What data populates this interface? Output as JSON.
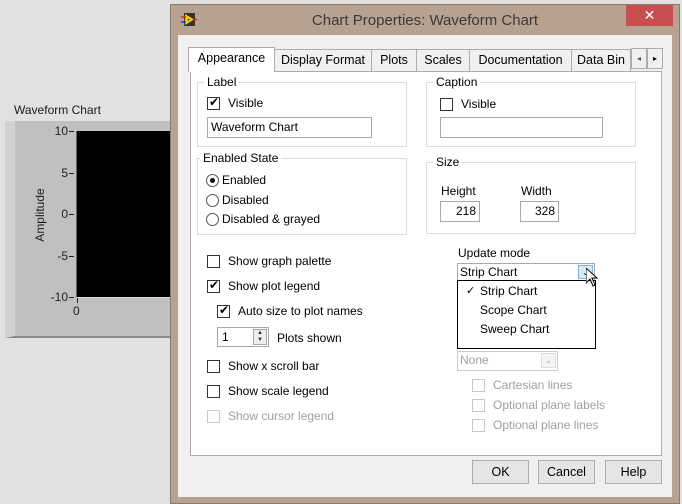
{
  "front_panel": {
    "chart_label": "Waveform Chart",
    "y_axis_label": "Amplitude",
    "y_ticks": [
      "10",
      "5",
      "0",
      "-5",
      "-10"
    ],
    "x_ticks": [
      "0"
    ]
  },
  "dialog": {
    "title": "Chart Properties: Waveform Chart",
    "close_glyph": "✕",
    "tabs": [
      {
        "label": "Appearance",
        "active": true
      },
      {
        "label": "Display Format"
      },
      {
        "label": "Plots"
      },
      {
        "label": "Scales"
      },
      {
        "label": "Documentation"
      },
      {
        "label": "Data Bin"
      }
    ],
    "tab_scroll_left": "◂",
    "tab_scroll_right": "▸",
    "label_group": {
      "title": "Label",
      "visible_label": "Visible",
      "visible_checked": true,
      "text_value": "Waveform Chart"
    },
    "caption_group": {
      "title": "Caption",
      "visible_label": "Visible",
      "visible_checked": false,
      "text_value": ""
    },
    "enabled_state": {
      "title": "Enabled State",
      "options": [
        "Enabled",
        "Disabled",
        "Disabled & grayed"
      ],
      "selected": "Enabled"
    },
    "size_group": {
      "title": "Size",
      "height_label": "Height",
      "height_value": "218",
      "width_label": "Width",
      "width_value": "328"
    },
    "options": {
      "show_graph_palette": "Show graph palette",
      "show_plot_legend": "Show plot legend",
      "auto_size": "Auto size to plot names",
      "plots_shown_value": "1",
      "plots_shown_label": "Plots shown",
      "show_x_scroll": "Show x scroll bar",
      "show_scale_legend": "Show scale legend",
      "show_cursor_legend": "Show cursor legend"
    },
    "update_mode": {
      "label": "Update mode",
      "value": "Strip Chart",
      "menu_items": [
        "Strip Chart",
        "Scope Chart",
        "Sweep Chart"
      ],
      "checked_item": "Strip Chart",
      "check_glyph": "✓",
      "arrow_glyph": "⌄"
    },
    "special_plane": {
      "value": "None",
      "arrow_glyph": "⌄"
    },
    "plane_options": [
      "Cartesian lines",
      "Optional plane labels",
      "Optional plane lines"
    ],
    "buttons": {
      "ok": "OK",
      "cancel": "Cancel",
      "help": "Help"
    }
  }
}
